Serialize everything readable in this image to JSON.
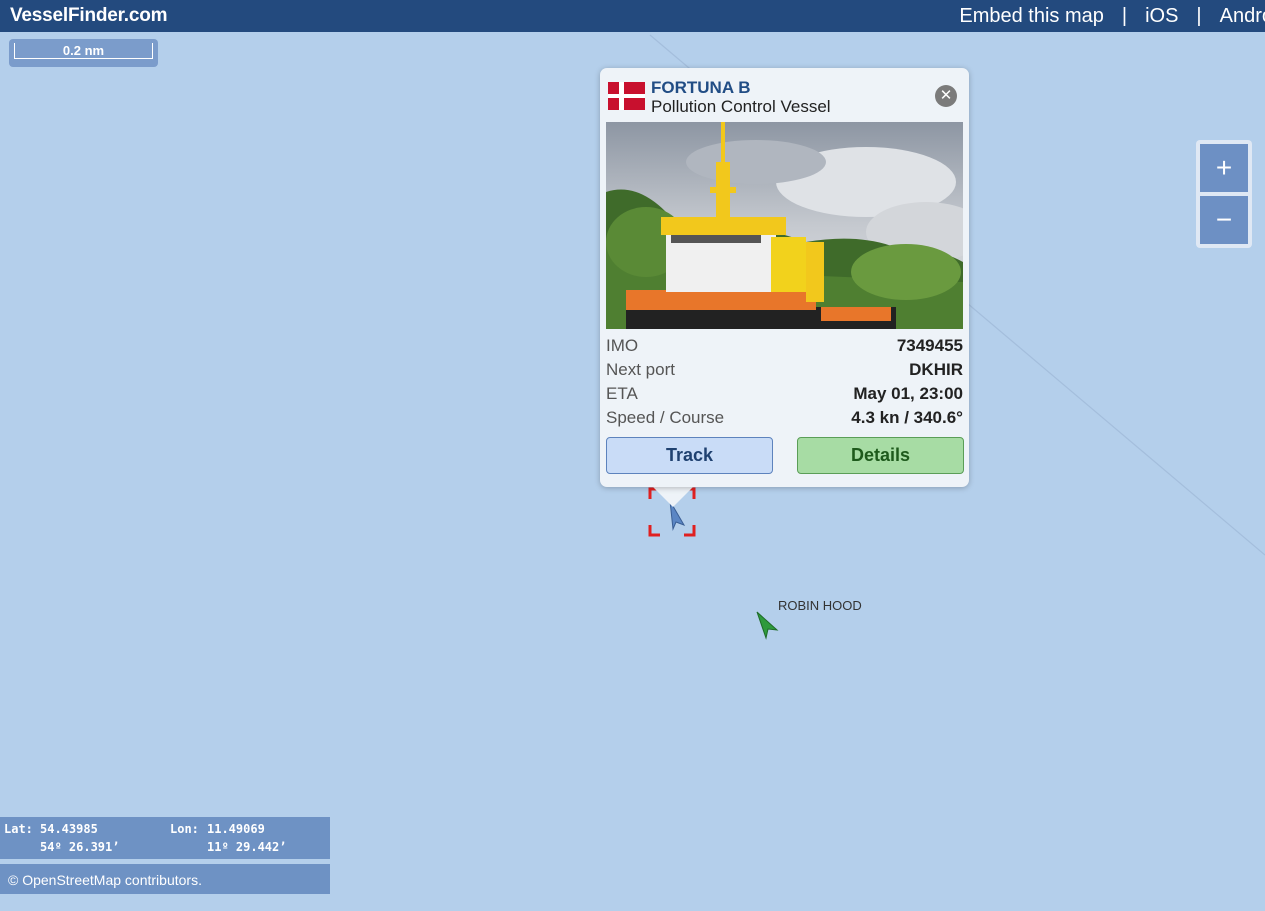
{
  "header": {
    "brand": "VesselFinder.com",
    "nav": [
      "Embed this map",
      "|",
      "iOS",
      "|",
      "Andro"
    ]
  },
  "scale": {
    "label": "0.2 nm"
  },
  "zoom": {
    "in_label": "+",
    "out_label": "−"
  },
  "popup": {
    "vessel_name": "FORTUNA B",
    "vessel_type": "Pollution Control Vessel",
    "close_label": "✕",
    "rows": [
      {
        "label": "IMO",
        "value": "7349455"
      },
      {
        "label": "Next port",
        "value": "DKHIR"
      },
      {
        "label": "ETA",
        "value": "May 01, 23:00"
      },
      {
        "label": "Speed / Course",
        "value": "4.3 kn / 340.6°"
      }
    ],
    "track_label": "Track",
    "details_label": "Details",
    "flag_icon": "denmark-flag-icon"
  },
  "other_vessel": {
    "name": "ROBIN HOOD",
    "icon": "vessel-arrow-icon",
    "color": "#2e9a3c"
  },
  "coords": {
    "lat_label": "Lat:",
    "lat_dec": "54.43985",
    "lat_dms": "54º 26.391’",
    "lon_label": "Lon:",
    "lon_dec": "11.49069",
    "lon_dms": "11º 29.442’"
  },
  "attribution": "© OpenStreetMap contributors.",
  "colors": {
    "sea": "#b4cfeb",
    "header": "#234a7e",
    "panel": "#6e92c4",
    "selection": "#e02020"
  }
}
